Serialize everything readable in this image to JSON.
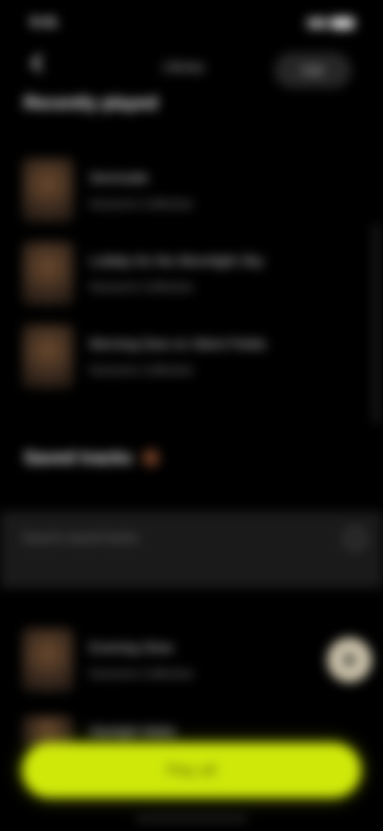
{
  "status_bar": {
    "time": "9:41"
  },
  "header": {
    "back_icon": "chevron-left-icon",
    "title": "Library",
    "action_label": "Edit"
  },
  "recent": {
    "title": "Recently played",
    "items": [
      {
        "title": "Serenade",
        "subtitle": "Nocturne Collective"
      },
      {
        "title": "Lullaby for the Moonlight Sky",
        "subtitle": "Nocturne Collective"
      },
      {
        "title": "Morning Dew on Silent Fields",
        "subtitle": "Nocturne Collective"
      }
    ]
  },
  "saved": {
    "title": "Saved tracks",
    "search_placeholder": "Search saved tracks",
    "items": [
      {
        "title": "Evening Glow",
        "subtitle": "Nocturne Collective"
      },
      {
        "title": "Starlight Waltz",
        "subtitle": ""
      }
    ]
  },
  "cta": {
    "label": "Play all"
  },
  "colors": {
    "accent": "#cfe80a",
    "background": "#000000"
  }
}
